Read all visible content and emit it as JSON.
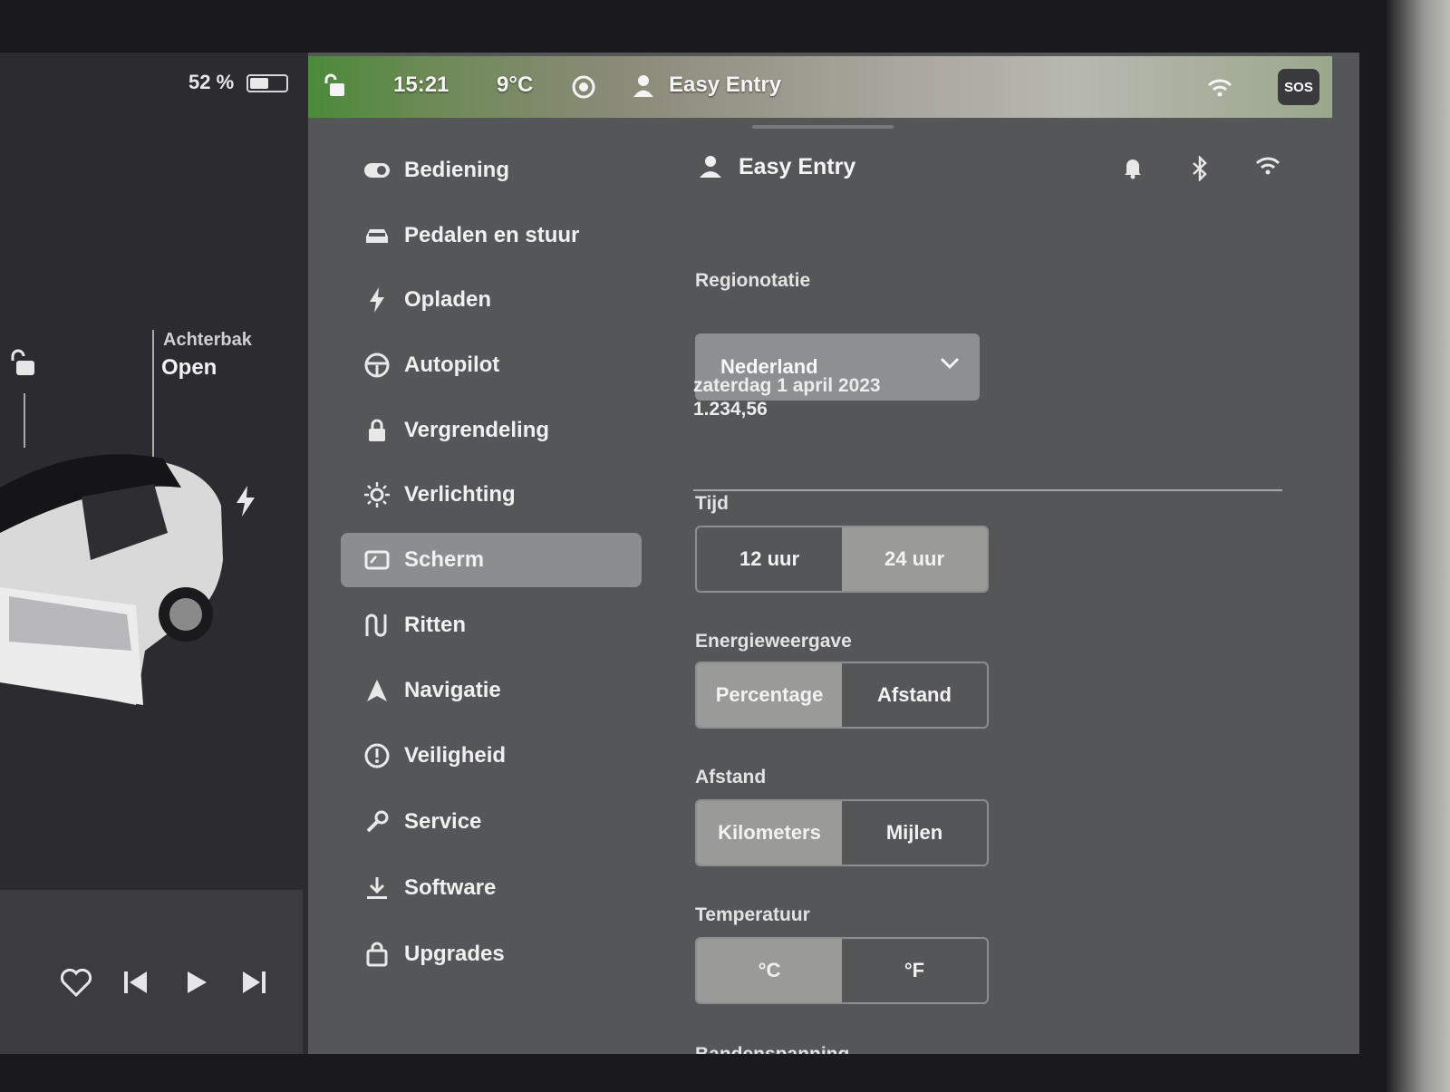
{
  "status": {
    "battery_percent_text": "52 %",
    "battery_level": 0.52,
    "time": "15:21",
    "temperature": "9°C",
    "profile": "Easy Entry",
    "sos": "SOS"
  },
  "car": {
    "trunk_label": "Achterbak",
    "trunk_status": "Open"
  },
  "menu": {
    "items": [
      {
        "label": "Bediening",
        "icon": "toggle-icon"
      },
      {
        "label": "Pedalen en stuur",
        "icon": "car-icon"
      },
      {
        "label": "Opladen",
        "icon": "bolt-icon"
      },
      {
        "label": "Autopilot",
        "icon": "steering-wheel-icon"
      },
      {
        "label": "Vergrendeling",
        "icon": "lock-icon"
      },
      {
        "label": "Verlichting",
        "icon": "sun-icon"
      },
      {
        "label": "Scherm",
        "icon": "display-icon",
        "active": true
      },
      {
        "label": "Ritten",
        "icon": "trips-icon"
      },
      {
        "label": "Navigatie",
        "icon": "navigation-icon"
      },
      {
        "label": "Veiligheid",
        "icon": "alert-icon"
      },
      {
        "label": "Service",
        "icon": "wrench-icon"
      },
      {
        "label": "Software",
        "icon": "download-icon"
      },
      {
        "label": "Upgrades",
        "icon": "shopping-bag-icon"
      }
    ]
  },
  "content": {
    "profile_name": "Easy Entry",
    "region": {
      "label": "Regionotatie",
      "value": "Nederland",
      "date_example": "zaterdag 1 april 2023",
      "number_example": "1.234,56"
    },
    "time": {
      "label": "Tijd",
      "options": [
        "12 uur",
        "24 uur"
      ],
      "selected": "24 uur"
    },
    "energy": {
      "label": "Energieweergave",
      "options": [
        "Percentage",
        "Afstand"
      ],
      "selected": "Percentage"
    },
    "distance": {
      "label": "Afstand",
      "options": [
        "Kilometers",
        "Mijlen"
      ],
      "selected": "Kilometers"
    },
    "temperature": {
      "label": "Temperatuur",
      "options": [
        "°C",
        "°F"
      ],
      "selected": "°C"
    },
    "tire_pressure": {
      "label": "Bandenspanning"
    }
  },
  "colors": {
    "background": "#555658",
    "selected": "#9a9a99",
    "car_panel": "#2b2b30"
  }
}
